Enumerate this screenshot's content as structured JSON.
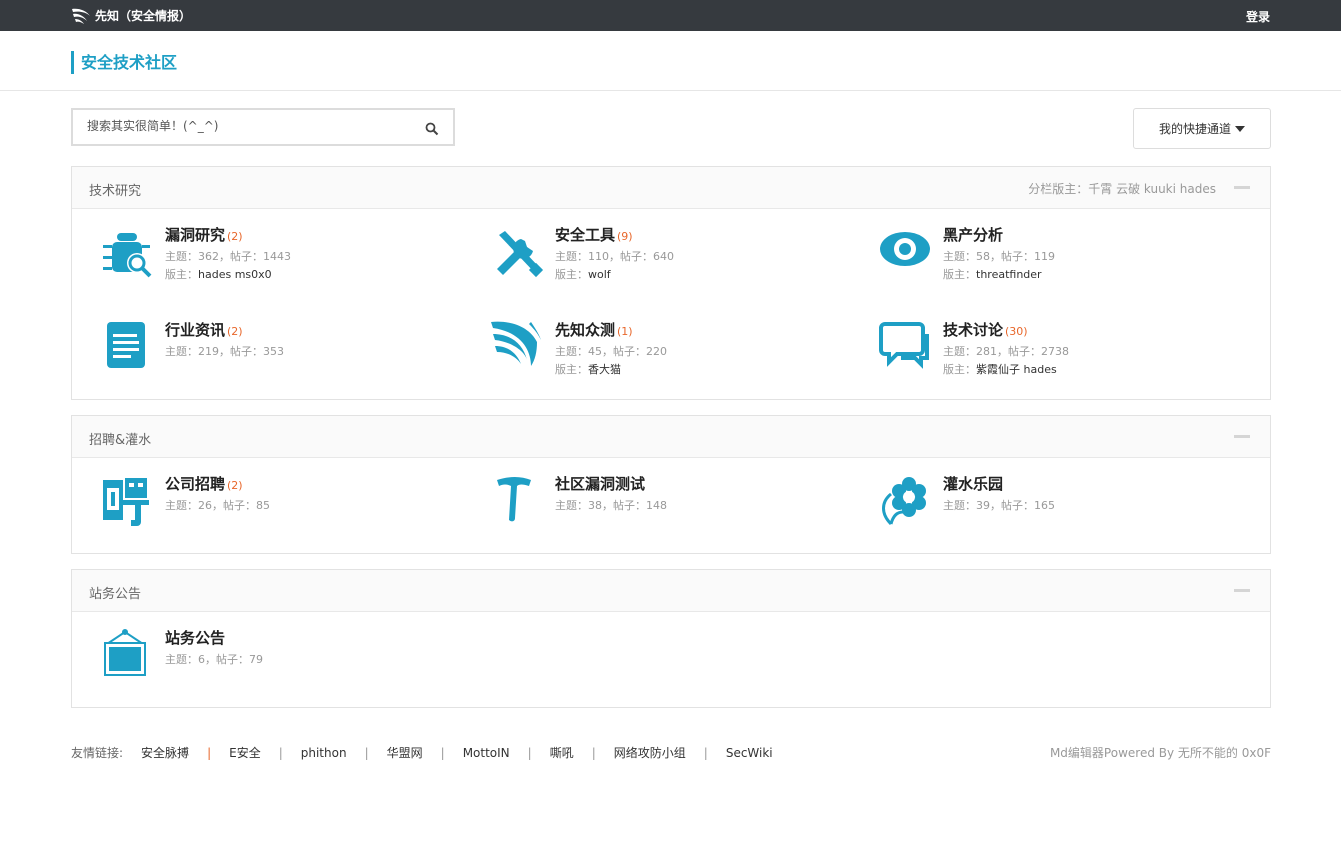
{
  "topbar": {
    "brand": "先知（安全情报）",
    "login": "登录"
  },
  "header": {
    "title": "安全技术社区"
  },
  "search": {
    "placeholder": "搜索其实很简单！(^_^)"
  },
  "quick_access": {
    "label": "我的快捷通道"
  },
  "colors": {
    "accent": "#1e9fc5",
    "count": "#e8672b",
    "topbar": "#363a3f"
  },
  "sections": [
    {
      "title": "技术研究",
      "moderators": "分栏版主：千霄 云破 kuuki hades",
      "forums": [
        {
          "icon": "bug-search-icon",
          "name": "漏洞研究",
          "count": "(2)",
          "stats": "主题：362，帖子：1443",
          "mods_label": "版主：",
          "mods": "hades ms0x0"
        },
        {
          "icon": "tools-icon",
          "name": "安全工具",
          "count": "(9)",
          "stats": "主题：110，帖子：640",
          "mods_label": "版主：",
          "mods": "wolf"
        },
        {
          "icon": "eye-icon",
          "name": "黑产分析",
          "count": "",
          "stats": "主题：58，帖子：119",
          "mods_label": "版主：",
          "mods": "threatfinder"
        },
        {
          "icon": "document-icon",
          "name": "行业资讯",
          "count": "(2)",
          "stats": "主题：219，帖子：353",
          "mods_label": "",
          "mods": ""
        },
        {
          "icon": "xianzhi-logo-icon",
          "name": "先知众测",
          "count": "(1)",
          "stats": "主题：45，帖子：220",
          "mods_label": "版主：",
          "mods": "香大猫"
        },
        {
          "icon": "chat-bubbles-icon",
          "name": "技术讨论",
          "count": "(30)",
          "stats": "主题：281，帖子：2738",
          "mods_label": "版主：",
          "mods": "紫霞仙子 hades"
        }
      ]
    },
    {
      "title": "招聘&灌水",
      "moderators": "",
      "forums": [
        {
          "icon": "recruit-icon",
          "name": "公司招聘",
          "count": "(2)",
          "stats": "主题：26，帖子：85",
          "mods_label": "",
          "mods": ""
        },
        {
          "icon": "t-shape-icon",
          "name": "社区漏洞测试",
          "count": "",
          "stats": "主题：38，帖子：148",
          "mods_label": "",
          "mods": ""
        },
        {
          "icon": "flower-icon",
          "name": "灌水乐园",
          "count": "",
          "stats": "主题：39，帖子：165",
          "mods_label": "",
          "mods": ""
        }
      ]
    },
    {
      "title": "站务公告",
      "moderators": "",
      "forums": [
        {
          "icon": "notice-board-icon",
          "name": "站务公告",
          "count": "",
          "stats": "主题：6，帖子：79",
          "mods_label": "",
          "mods": ""
        }
      ]
    }
  ],
  "footer": {
    "links_label": "友情链接:",
    "links": [
      "安全脉搏",
      "E安全",
      "phithon",
      "华盟网",
      "MottoIN",
      "嘶吼",
      "网络攻防小组",
      "SecWiki"
    ],
    "powered": "Md编辑器Powered By 无所不能的 0x0F"
  }
}
